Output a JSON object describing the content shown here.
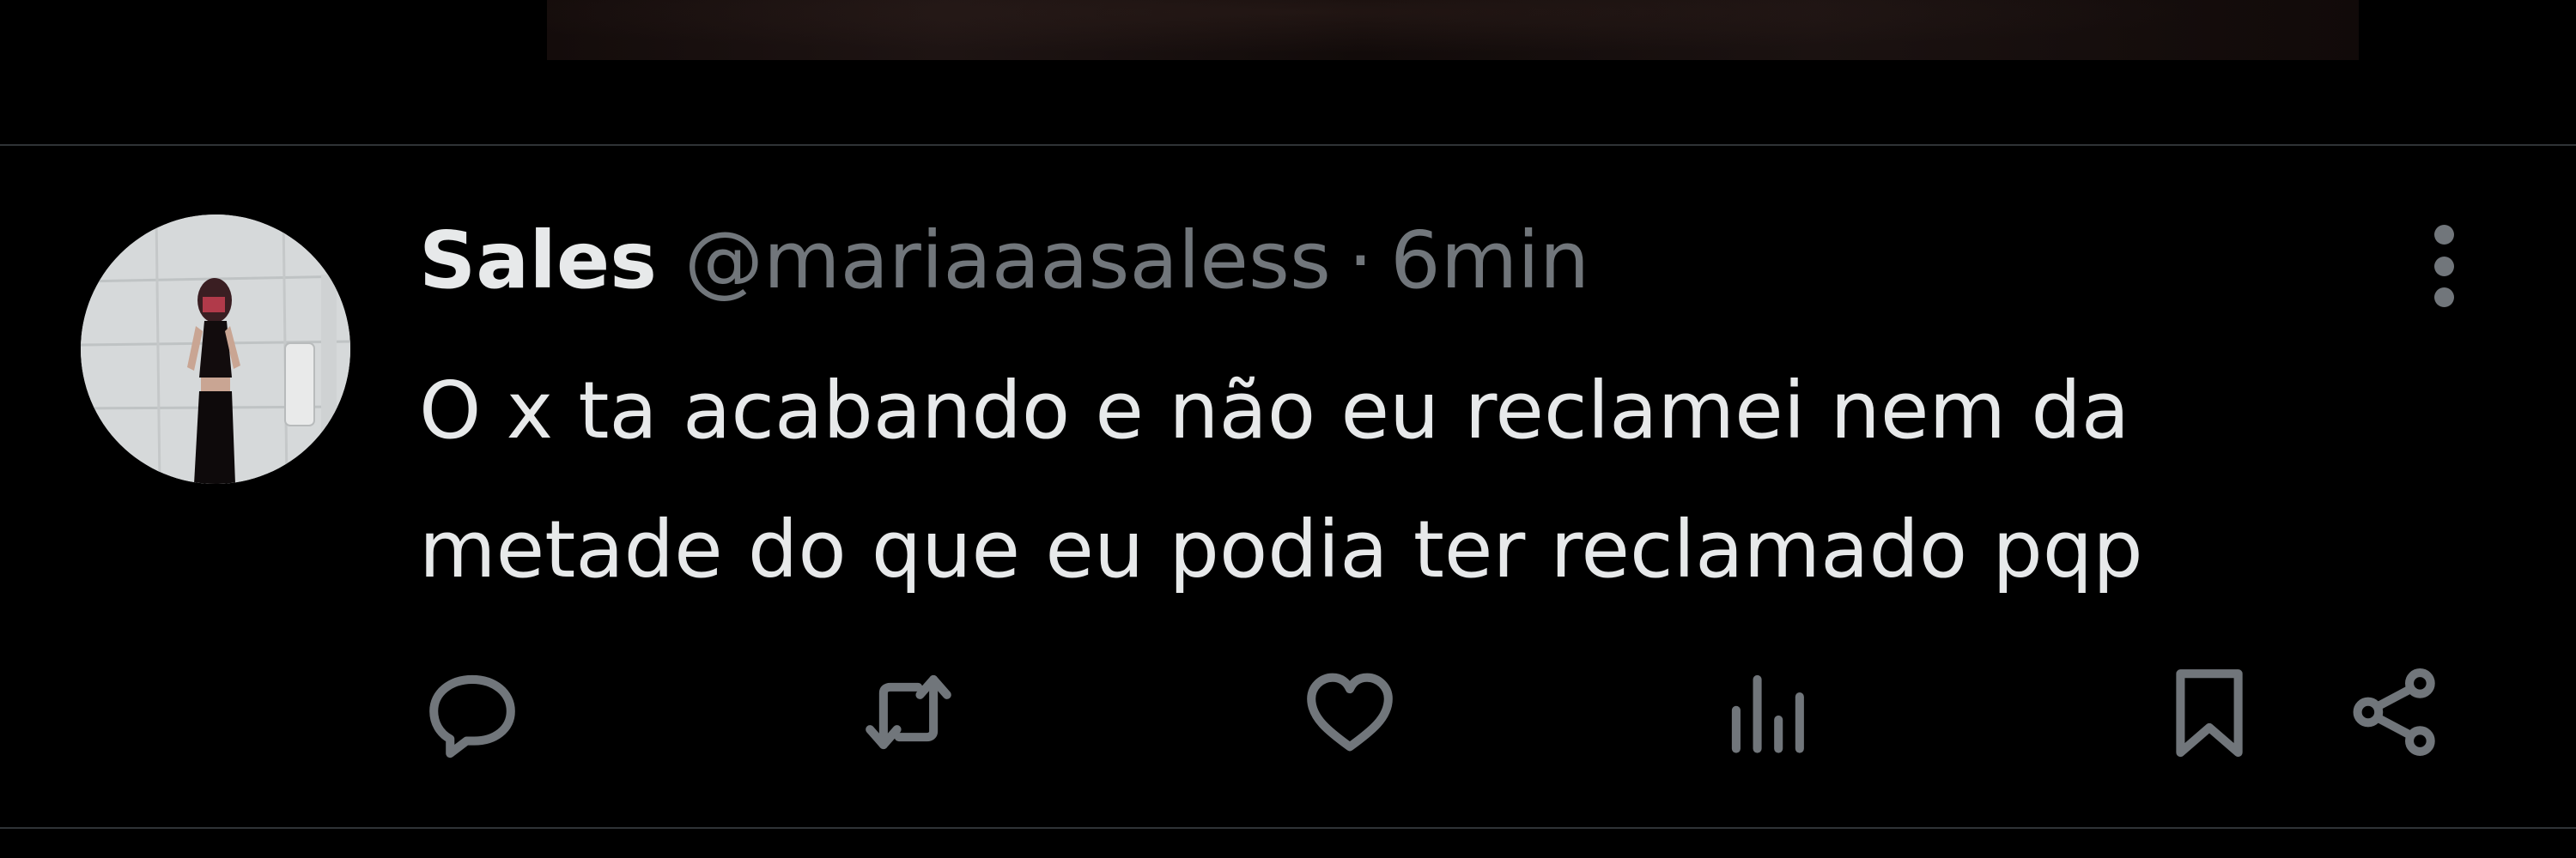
{
  "tweet": {
    "author": {
      "display_name": "Sales",
      "handle": "@mariaaasaless"
    },
    "separator": "·",
    "timestamp": "6min",
    "text_lines": [
      "O x ta acabando e não eu reclamei nem da",
      "metade do que eu podia ter reclamado pqp"
    ]
  },
  "actions": [
    "reply-icon",
    "retweet-icon",
    "like-icon",
    "views-icon",
    "bookmark-icon",
    "share-icon"
  ],
  "theme": {
    "background": "#000000",
    "text": "#e7e9ea",
    "muted": "#71767b",
    "divider": "#2f3336"
  }
}
